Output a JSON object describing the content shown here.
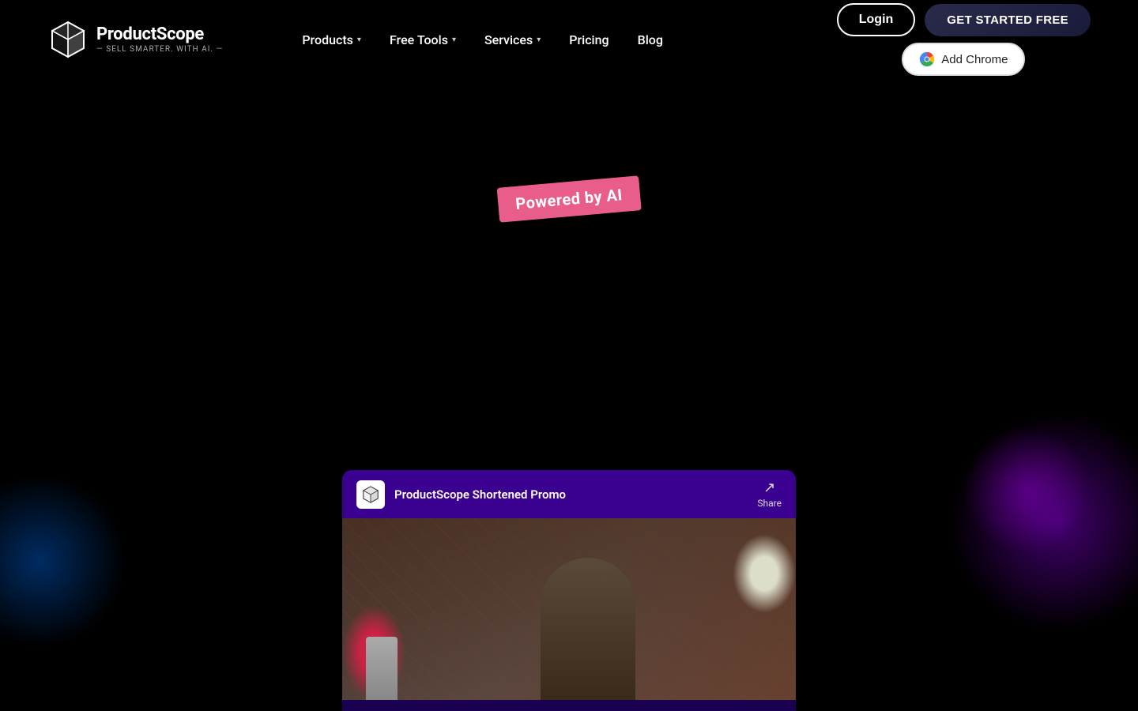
{
  "brand": {
    "name": "ProductScope",
    "tagline": "— SELL SMARTER. WITH AI. —",
    "logo_alt": "ProductScope logo"
  },
  "nav": {
    "products_label": "Products",
    "free_tools_label": "Free Tools",
    "services_label": "Services",
    "pricing_label": "Pricing",
    "blog_label": "Blog"
  },
  "actions": {
    "login_label": "Login",
    "get_started_label": "GET STARTED FREE",
    "add_chrome_label": "Add Chrome"
  },
  "hero": {
    "badge_label": "Powered by AI"
  },
  "video": {
    "channel_name": "ProductScope Shortened Promo",
    "share_label": "Share"
  },
  "colors": {
    "accent_pink": "#e85d8a",
    "nav_bg": "transparent",
    "body_bg": "#000000"
  }
}
